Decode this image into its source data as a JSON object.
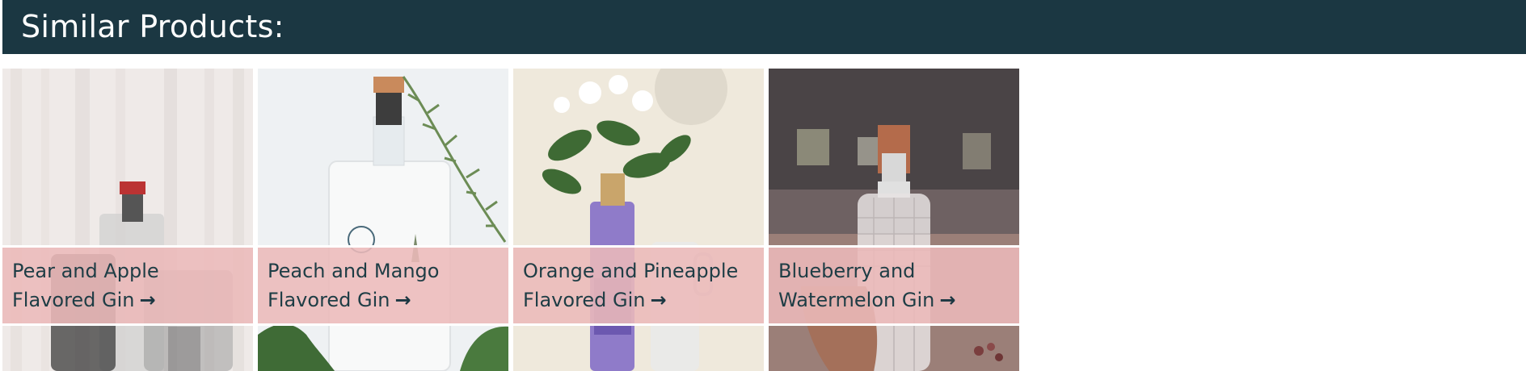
{
  "header": {
    "title": "Similar Products:",
    "background": "#1b3742"
  },
  "products": [
    {
      "line1": "Pear and Apple",
      "line2": "Flavored Gin",
      "arrow": "→"
    },
    {
      "line1": "Peach and Mango",
      "line2": "Flavored Gin",
      "arrow": "→"
    },
    {
      "line1": "Orange and Pineapple",
      "line2": "Flavored Gin",
      "arrow": "→"
    },
    {
      "line1": "Blueberry and",
      "line2": "Watermelon Gin",
      "arrow": "→"
    }
  ],
  "colors": {
    "band": "#ecbaba",
    "band_text": "#1e3d45"
  },
  "icons": {
    "card_link": "arrow-right-icon"
  }
}
